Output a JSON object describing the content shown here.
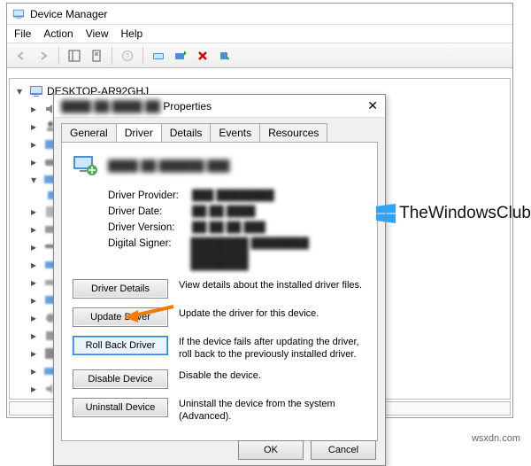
{
  "window": {
    "title": "Device Manager",
    "menu": [
      "File",
      "Action",
      "View",
      "Help"
    ]
  },
  "tree": {
    "root": "DESKTOP-AR92GHJ",
    "child": "Audio inputs and outputs"
  },
  "dialog": {
    "title_suffix": "Properties",
    "tabs": [
      "General",
      "Driver",
      "Details",
      "Events",
      "Resources"
    ],
    "fields": {
      "provider_label": "Driver Provider:",
      "date_label": "Driver Date:",
      "version_label": "Driver Version:",
      "signer_label": "Digital Signer:"
    },
    "buttons": {
      "details": "Driver Details",
      "update": "Update Driver",
      "rollback": "Roll Back Driver",
      "disable": "Disable Device",
      "uninstall": "Uninstall Device"
    },
    "descriptions": {
      "details": "View details about the installed driver files.",
      "update": "Update the driver for this device.",
      "rollback": "If the device fails after updating the driver, roll back to the previously installed driver.",
      "disable": "Disable the device.",
      "uninstall": "Uninstall the device from the system (Advanced)."
    },
    "ok": "OK",
    "cancel": "Cancel"
  },
  "watermark": "TheWindowsClub",
  "source": "wsxdn.com"
}
